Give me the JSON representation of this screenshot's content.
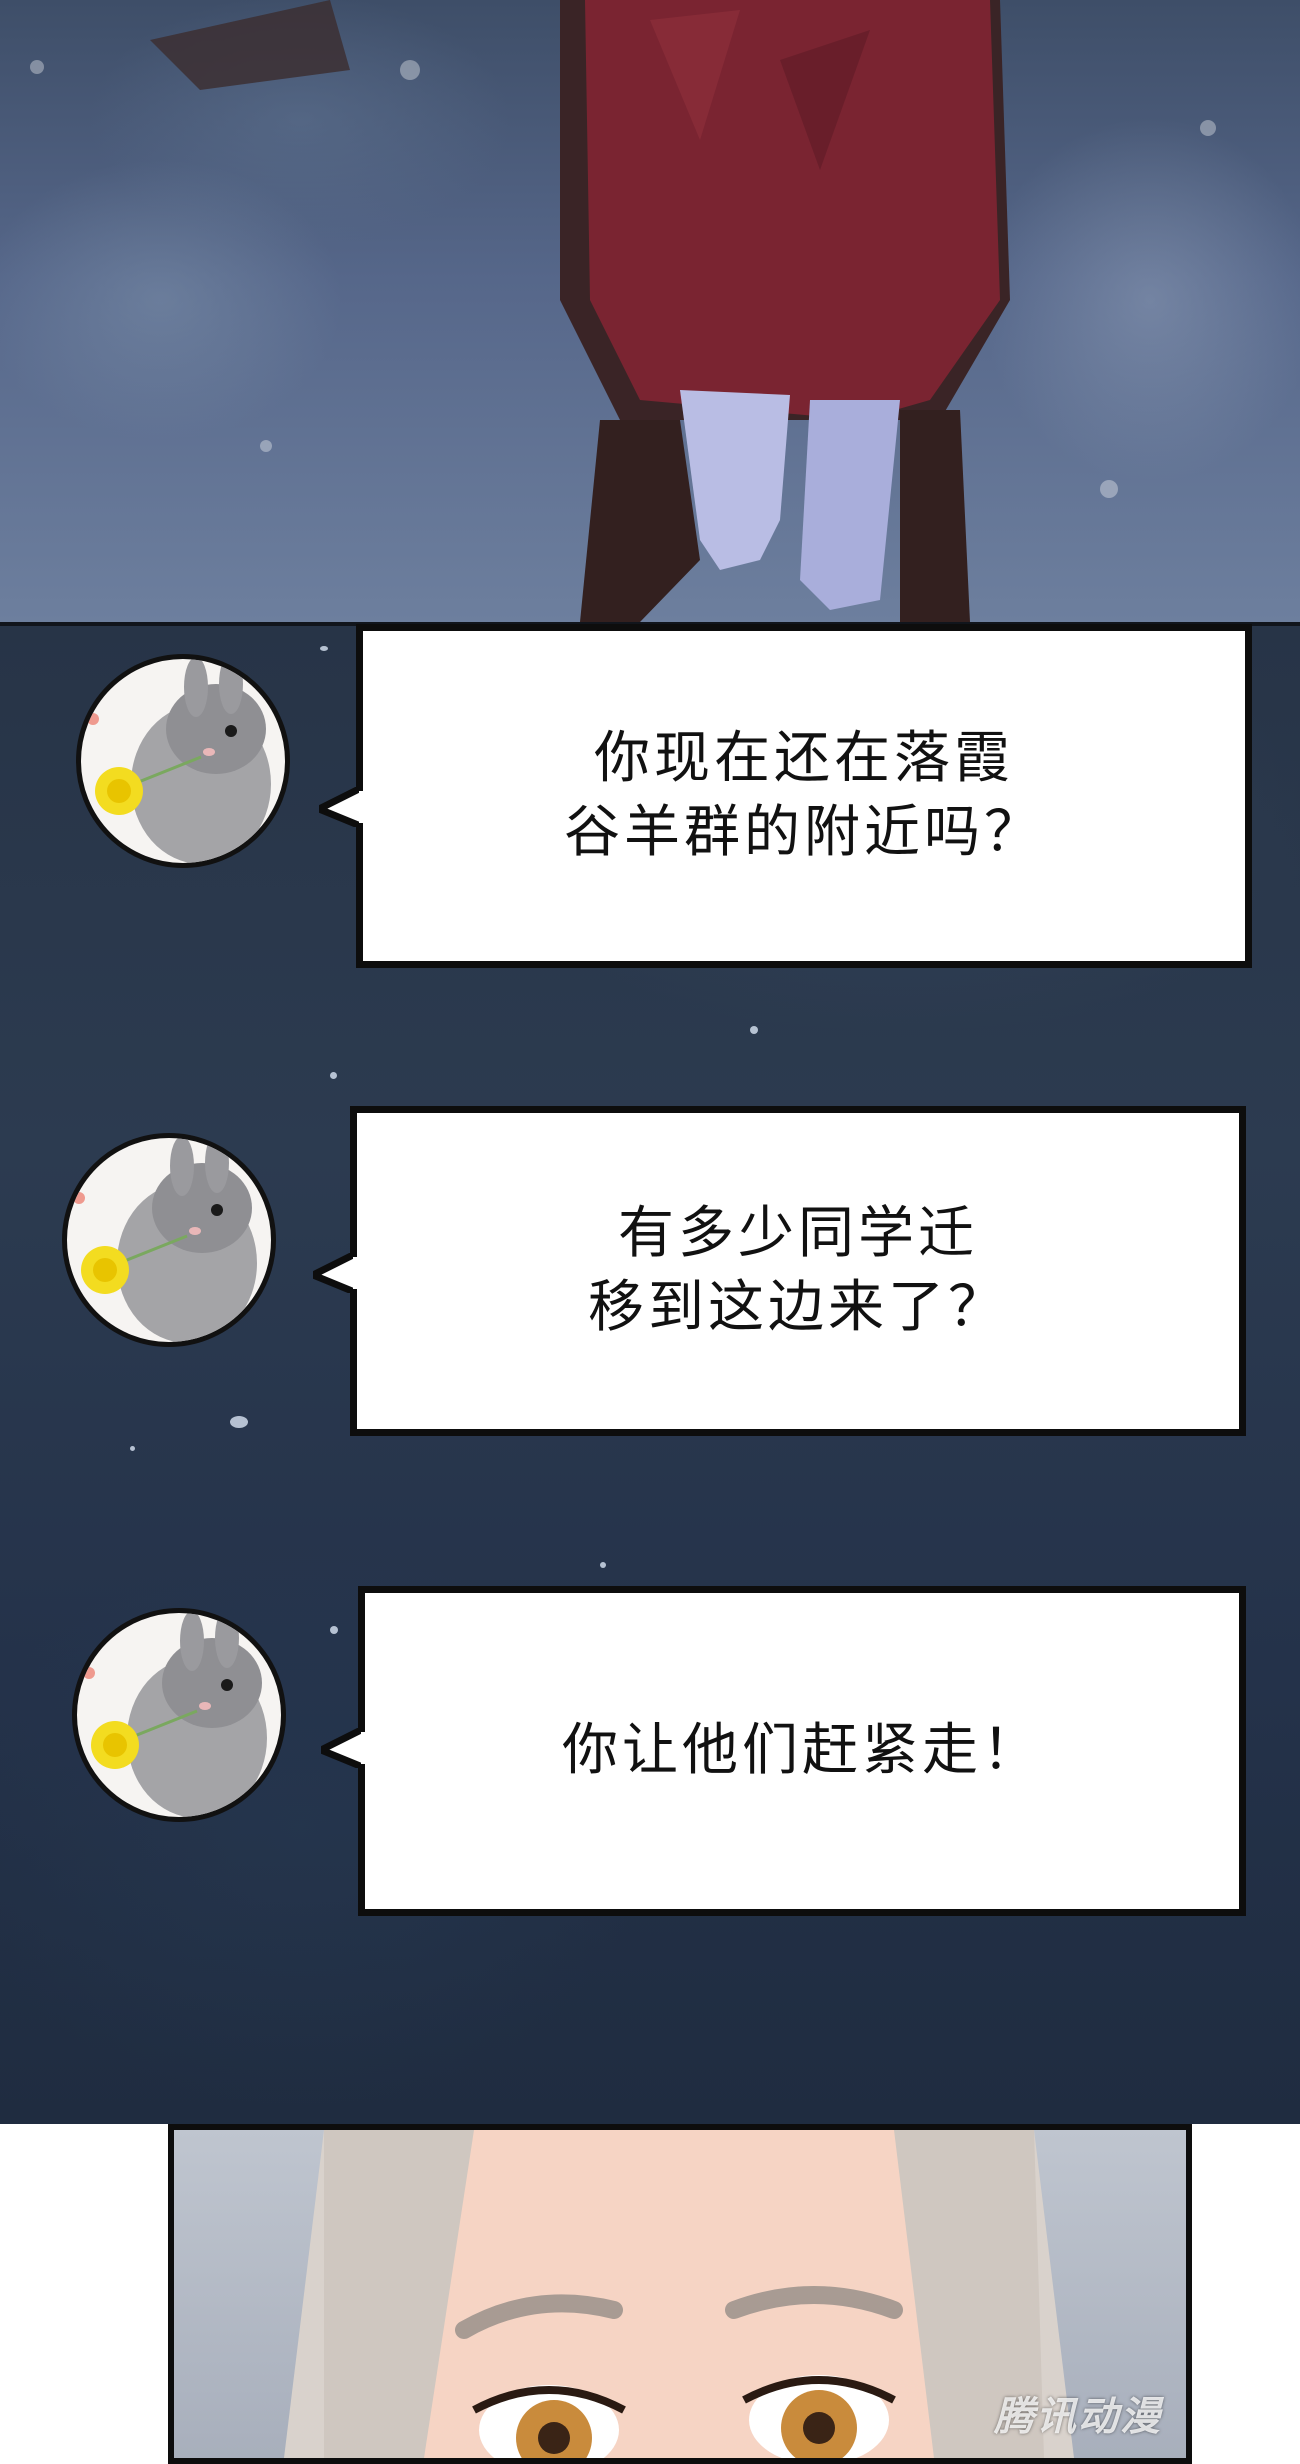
{
  "messages": [
    {
      "lines": [
        "你现在还在落霞",
        "谷羊群的附近吗？"
      ]
    },
    {
      "lines": [
        "有多少同学迁",
        "移到这边来了？"
      ]
    },
    {
      "lines": [
        "你让他们赶紧走！"
      ]
    }
  ],
  "avatar_icon": "rabbit-with-dandelion-icon",
  "watermark": "腾讯动漫",
  "colors": {
    "night_sky": "#2c3b50",
    "bubble_fill": "#ffffff",
    "bubble_border": "#0d0d0d",
    "robe_red": "#7a2431",
    "hair": "#d9d2cc",
    "eye_amber": "#c98b3c"
  }
}
